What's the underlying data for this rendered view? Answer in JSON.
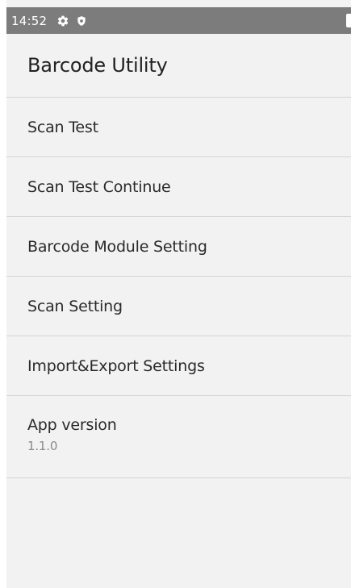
{
  "status_bar": {
    "time": "14:52",
    "icons": [
      "settings-gear-icon",
      "shield-icon",
      "battery-icon"
    ]
  },
  "app_bar": {
    "title": "Barcode Utility"
  },
  "menu": {
    "items": [
      {
        "label": "Scan Test"
      },
      {
        "label": "Scan Test Continue"
      },
      {
        "label": "Barcode Module Setting"
      },
      {
        "label": "Scan Setting"
      },
      {
        "label": "Import&Export Settings"
      }
    ],
    "app_version": {
      "label": "App version",
      "value": "1.1.0"
    }
  },
  "colors": {
    "status_bar": "#7c7c7c",
    "background": "#f2f2f2",
    "divider": "#d4d4d4",
    "primary_text": "#2a2a2a",
    "secondary_text": "#8a8a8a"
  }
}
